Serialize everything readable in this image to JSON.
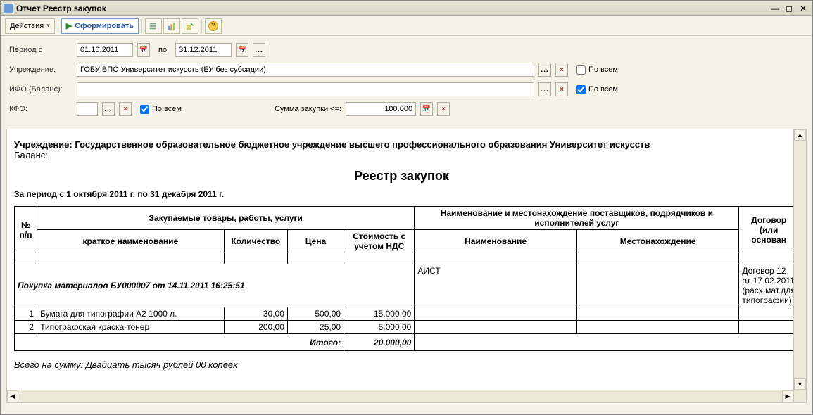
{
  "window": {
    "title": "Отчет  Реестр закупок"
  },
  "toolbar": {
    "actions": "Действия",
    "form": "Сформировать"
  },
  "filters": {
    "period_label": "Период с",
    "period_from": "01.10.2011",
    "period_to_label": "по",
    "period_to": "31.12.2011",
    "org_label": "Учреждение:",
    "org_value": "ГОБУ ВПО Университет искусств (БУ без субсидии)",
    "ifo_label": "ИФО (Баланс):",
    "ifo_value": "",
    "kfo_label": "КФО:",
    "kfo_value": "",
    "all_label": "По всем",
    "sum_label": "Сумма закупки <=:",
    "sum_value": "100.000"
  },
  "report": {
    "org_prefix": "Учреждение: ",
    "org_full": "Государственное образовательное бюджетное учреждение высшего профессионального образования  Университет искусств",
    "balance_label": "Баланс:",
    "title": "Реестр закупок",
    "period_text": "За период с 1 октября 2011 г. по 31 декабря 2011 г.",
    "headers": {
      "npp": "№ п/п",
      "goods": "Закупаемые товары, работы, услуги",
      "short_name": "краткое наименование",
      "qty": "Количество",
      "price": "Цена",
      "cost": "Стоимость с учетом НДС",
      "suppliers": "Наименование и местонахождение поставщиков, подрядчиков и исполнителей услуг",
      "sup_name": "Наименование",
      "sup_loc": "Местонахождение",
      "contract": "Договор (или основан"
    },
    "group": {
      "label": "Покупка материалов БУ000007 от 14.11.2011 16:25:51",
      "supplier": "АИСТ",
      "contract": "Договор 12 от 17.02.2011 (расх.мат.для типографии)"
    },
    "rows": [
      {
        "n": "1",
        "name": "Бумага для типографии А2 1000 л.",
        "qty": "30,00",
        "price": "500,00",
        "cost": "15.000,00"
      },
      {
        "n": "2",
        "name": "Типографская краска-тонер",
        "qty": "200,00",
        "price": "25,00",
        "cost": "5.000,00"
      }
    ],
    "total_label": "Итого:",
    "total_value": "20.000,00",
    "in_words": "Всего на сумму: Двадцать тысяч рублей 00 копеек"
  }
}
